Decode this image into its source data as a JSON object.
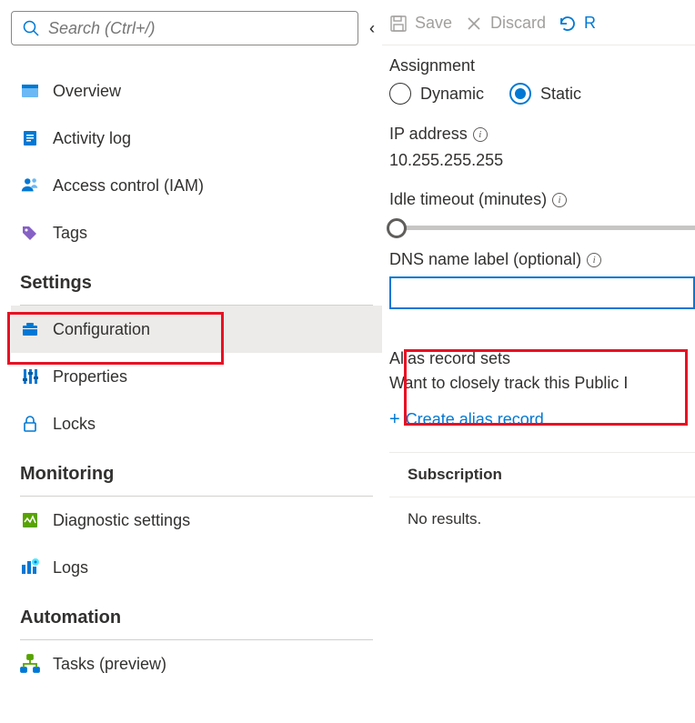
{
  "search": {
    "placeholder": "Search (Ctrl+/)"
  },
  "nav": {
    "top": [
      {
        "label": "Overview"
      },
      {
        "label": "Activity log"
      },
      {
        "label": "Access control (IAM)"
      },
      {
        "label": "Tags"
      }
    ],
    "settings_header": "Settings",
    "settings": [
      {
        "label": "Configuration"
      },
      {
        "label": "Properties"
      },
      {
        "label": "Locks"
      }
    ],
    "monitoring_header": "Monitoring",
    "monitoring": [
      {
        "label": "Diagnostic settings"
      },
      {
        "label": "Logs"
      }
    ],
    "automation_header": "Automation",
    "automation": [
      {
        "label": "Tasks (preview)"
      }
    ]
  },
  "toolbar": {
    "save": "Save",
    "discard": "Discard",
    "refresh_initial": "R"
  },
  "form": {
    "assignment_label": "Assignment",
    "dynamic": "Dynamic",
    "static": "Static",
    "ip_label": "IP address",
    "ip_value": "10.255.255.255",
    "idle_label": "Idle timeout (minutes)",
    "dns_label": "DNS name label (optional)",
    "alias_header": "Alias record sets",
    "alias_text": "Want to closely track this Public I",
    "create_alias": "Create alias record",
    "subscription": "Subscription",
    "no_results": "No results."
  }
}
